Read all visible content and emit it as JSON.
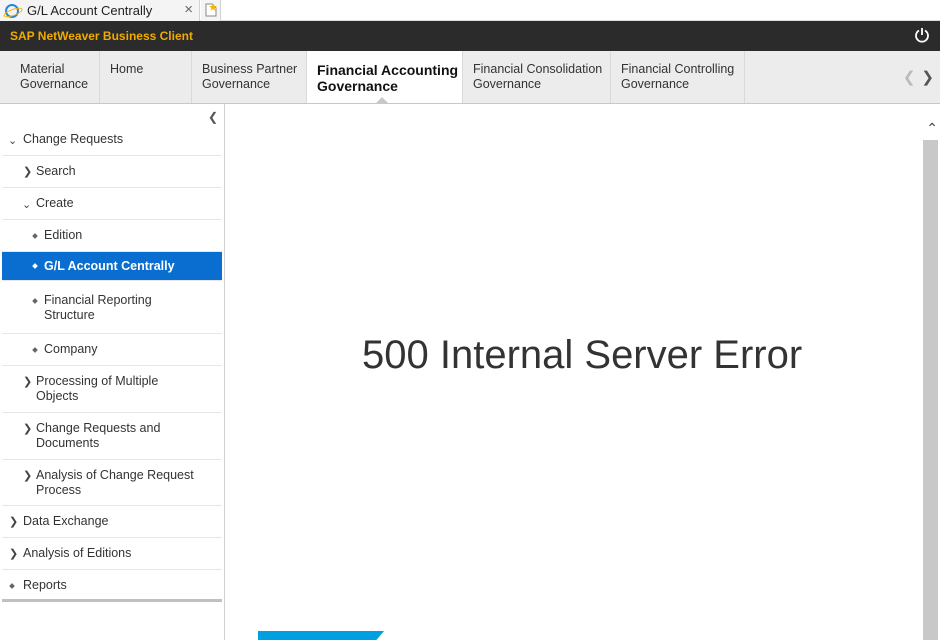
{
  "browser": {
    "tab_title": "G/L Account Centrally",
    "close_glyph": "×"
  },
  "app": {
    "title": "SAP NetWeaver Business Client"
  },
  "topnav": {
    "items": [
      {
        "label_1": "Material",
        "label_2": "Governance"
      },
      {
        "label_1": "Home",
        "label_2": ""
      },
      {
        "label_1": "Business Partner",
        "label_2": "Governance"
      },
      {
        "label_1": "Financial Accounting",
        "label_2": "Governance"
      },
      {
        "label_1": "Financial Consolidation",
        "label_2": "Governance"
      },
      {
        "label_1": "Financial Controlling",
        "label_2": "Governance"
      }
    ],
    "active_index": 3
  },
  "sidebar": {
    "items": [
      {
        "label": "Change Requests"
      },
      {
        "label": "Search"
      },
      {
        "label": "Create"
      },
      {
        "label": "Edition"
      },
      {
        "label": "G/L Account Centrally"
      },
      {
        "label_1": "Financial Reporting",
        "label_2": "Structure"
      },
      {
        "label": "Company"
      },
      {
        "label_1": "Processing of Multiple",
        "label_2": "Objects"
      },
      {
        "label_1": "Change Requests and",
        "label_2": "Documents"
      },
      {
        "label_1": "Analysis of Change Request",
        "label_2": "Process"
      },
      {
        "label": "Data Exchange"
      },
      {
        "label": "Analysis of Editions"
      },
      {
        "label": "Reports"
      }
    ]
  },
  "content": {
    "error_message": "500 Internal Server Error"
  },
  "colors": {
    "brand": "#f0ab00",
    "header_bg": "#2b2b2b",
    "selection": "#0a6ed1",
    "accent_bar": "#00a0e0"
  }
}
